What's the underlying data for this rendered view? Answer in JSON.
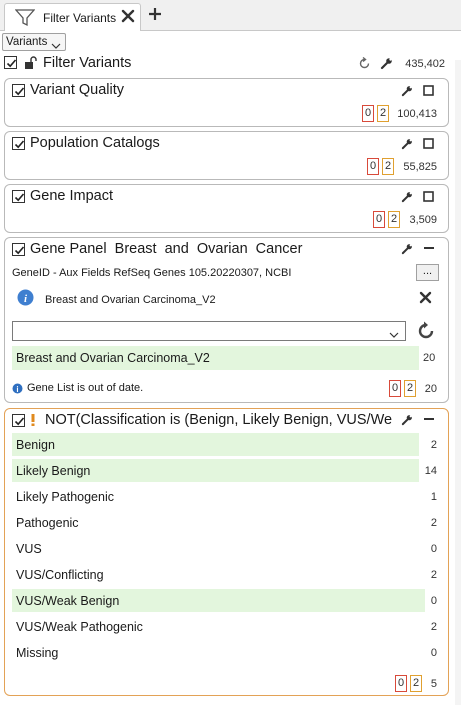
{
  "tab": {
    "label": "Filter Variants"
  },
  "dropdown": {
    "value": "Variants"
  },
  "root": {
    "title": "Filter Variants",
    "count": "435,402"
  },
  "cards": {
    "variant_quality": {
      "title": "Variant Quality",
      "badge_a": "0",
      "badge_b": "2",
      "count": "100,413"
    },
    "population_catalogs": {
      "title": "Population Catalogs",
      "badge_a": "0",
      "badge_b": "2",
      "count": "55,825"
    },
    "gene_impact": {
      "title": "Gene Impact",
      "badge_a": "0",
      "badge_b": "2",
      "count": "3,509"
    },
    "gene_panel": {
      "title": "Gene Panel  Breast  and  Ovarian  Cancer",
      "source": "GeneID - Aux Fields RefSeq Genes 105.20220307, NCBI",
      "ellipsis": "...",
      "list_name": "Breast and Ovarian Carcinoma_V2",
      "combo_value": "",
      "rows": [
        {
          "label": "Breast and Ovarian Carcinoma_V2",
          "count": "20"
        }
      ],
      "warning": "Gene List is out of date.",
      "badge_a": "0",
      "badge_b": "2",
      "count": "20"
    },
    "classification": {
      "title": "NOT(Classification is (Benign, Likely Benign, VUS/We",
      "rows": [
        {
          "label": "Benign",
          "count": "2",
          "selected": true
        },
        {
          "label": "Likely Benign",
          "count": "14",
          "selected": true
        },
        {
          "label": "Likely Pathogenic",
          "count": "1",
          "selected": false
        },
        {
          "label": "Pathogenic",
          "count": "2",
          "selected": false
        },
        {
          "label": "VUS",
          "count": "0",
          "selected": false
        },
        {
          "label": "VUS/Conflicting",
          "count": "2",
          "selected": false
        },
        {
          "label": "VUS/Weak Benign",
          "count": "0",
          "selected": true
        },
        {
          "label": "VUS/Weak Pathogenic",
          "count": "2",
          "selected": false
        },
        {
          "label": "Missing",
          "count": "0",
          "selected": false
        }
      ],
      "badge_a": "0",
      "badge_b": "2",
      "count": "5"
    }
  },
  "colors": {
    "selected_row": "#e3f6dd",
    "badge_red": "#d84a3a",
    "badge_yellow": "#e0a030",
    "card_orange": "#e3a256",
    "info_blue": "#3f7fd0"
  }
}
